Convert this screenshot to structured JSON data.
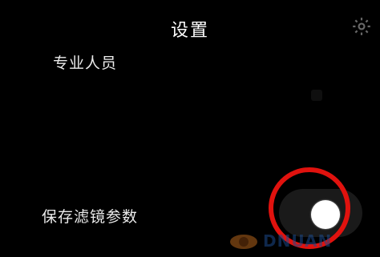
{
  "header": {
    "title": "设置",
    "settings_icon": "gear-icon"
  },
  "settings": [
    {
      "label": "专业人员"
    },
    {
      "label": "保存滤镜参数",
      "toggle_on": true
    }
  ],
  "highlight_color": "#e0120e",
  "watermark": {
    "text": "DNUAN"
  }
}
